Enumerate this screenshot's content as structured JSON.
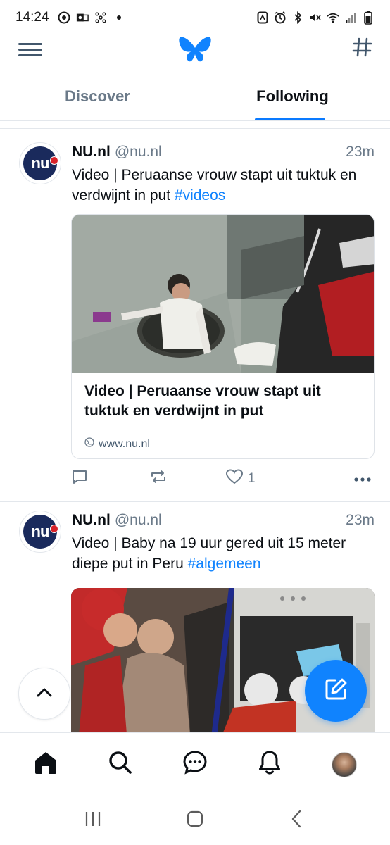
{
  "status_bar": {
    "time": "14:24",
    "left_icons": [
      "chrome-icon",
      "outlook-icon",
      "network-icon",
      "dot-icon"
    ],
    "right_icons": [
      "nfc-icon",
      "alarm-icon",
      "bluetooth-icon",
      "mute-icon",
      "wifi-icon",
      "signal-icon",
      "battery-icon"
    ]
  },
  "header": {
    "menu_icon": "hamburger-icon",
    "logo": "butterfly-logo",
    "feeds_icon": "hash-icon"
  },
  "tabs": [
    {
      "label": "Discover",
      "active": false
    },
    {
      "label": "Following",
      "active": true
    }
  ],
  "posts": [
    {
      "author_name": "NU.nl",
      "author_handle": "@nu.nl",
      "time": "23m",
      "avatar_text": "nu",
      "avatar_badge": "nl",
      "text": "Video | Peruaanse vrouw stapt uit tuktuk en verdwijnt in put ",
      "hashtag": "#videos",
      "card": {
        "title": "Video | Peruaanse vrouw stapt uit tuktuk en verdwijnt in put",
        "domain": "www.nu.nl"
      },
      "reply_count": "",
      "repost_count": "",
      "like_count": "1"
    },
    {
      "author_name": "NU.nl",
      "author_handle": "@nu.nl",
      "time": "23m",
      "avatar_text": "nu",
      "avatar_badge": "nl",
      "text": "Video | Baby na 19 uur gered uit 15 meter diepe put in Peru ",
      "hashtag": "#algemeen"
    }
  ],
  "bottom_nav": [
    "home-icon",
    "search-icon",
    "chat-icon",
    "bell-icon",
    "profile-avatar"
  ],
  "colors": {
    "accent": "#1083fe",
    "text": "#0b0f14",
    "muted": "#6b7a89"
  }
}
